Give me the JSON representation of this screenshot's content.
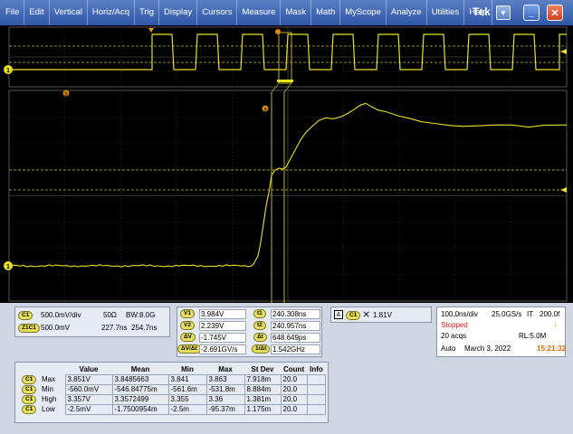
{
  "menubar": {
    "items": [
      "File",
      "Edit",
      "Vertical",
      "Horiz/Acq",
      "Trig",
      "Display",
      "Cursors",
      "Measure",
      "Mask",
      "Math",
      "MyScope",
      "Analyze",
      "Utilities",
      "Help"
    ],
    "brand": "Tek",
    "dropdown_icon": "triangle-down-icon",
    "minimize_icon": "underscore",
    "close_icon": "x"
  },
  "colors": {
    "trace": "#e8e020",
    "grid": "#4a4a4a",
    "accent": "#2f56a8",
    "stopped": "#e01818",
    "clock": "#e06a00"
  },
  "scope": {
    "ch1_marker": "1",
    "cursor_a_label": "a",
    "cursor_b_label": "b",
    "upper_trace_level": "high/low square wave, 10 cycles",
    "lower_trace": "rising edge at ~0.47 screen width"
  },
  "channel_panel": {
    "c1_badge": "C1",
    "c1_scale": "500.0mV/div",
    "c1_imped": "50Ω",
    "c1_bw": "BW:8.0G",
    "z1_badge": "Z1C1",
    "z1_scale": "500.0mV",
    "z1_pos": "227.7ns",
    "z1_time": "254.7ns"
  },
  "cursor_panel": {
    "v1_label": "V1",
    "v1": "3.984V",
    "v2_label": "V2",
    "v2": "2.239V",
    "dv_label": "ΔV",
    "dv": "-1.745V",
    "dvdt_label": "ΔV/Δt",
    "dvdt": "-2.691GV/s",
    "t1_label": "t1",
    "t1": "240.308ns",
    "t2_label": "t2",
    "t2": "240.957ns",
    "dt_label": "Δt",
    "dt": "648.649ps",
    "inv_label": "1/Δt",
    "inv": "1.542GHz"
  },
  "trigger_panel": {
    "badge": "C1",
    "level": "1.81V"
  },
  "acq_panel": {
    "timebase": "100.0ns/div",
    "rate": "25.0GS/s",
    "it": "IT",
    "it_val": "200.0f",
    "status": "Stopped",
    "acqs": "20 acqs",
    "rl": "RL:5.0M",
    "mode": "Auto",
    "date": "March 3, 2022",
    "time": "15:21:32"
  },
  "measurements": {
    "headers": [
      "Value",
      "Mean",
      "Min",
      "Max",
      "St Dev",
      "Count",
      "Info"
    ],
    "rows": [
      {
        "badge": "C1",
        "name": "Max",
        "cells": [
          "3.851V",
          "3.8485663",
          "3.841",
          "3.863",
          "7.918m",
          "20.0",
          ""
        ]
      },
      {
        "badge": "C1",
        "name": "Min",
        "cells": [
          "-560.0mV",
          "-546.84775m",
          "-561.6m",
          "-531.8m",
          "8.884m",
          "20.0",
          ""
        ]
      },
      {
        "badge": "C1",
        "name": "High",
        "cells": [
          "3.357V",
          "3.3572499",
          "3.355",
          "3.36",
          "1.381m",
          "20.0",
          ""
        ]
      },
      {
        "badge": "C1",
        "name": "Low",
        "cells": [
          "-2.5mV",
          "-1.7500954m",
          "-2.5m",
          "-95.37m",
          "1.175m",
          "20.0",
          ""
        ]
      }
    ]
  }
}
